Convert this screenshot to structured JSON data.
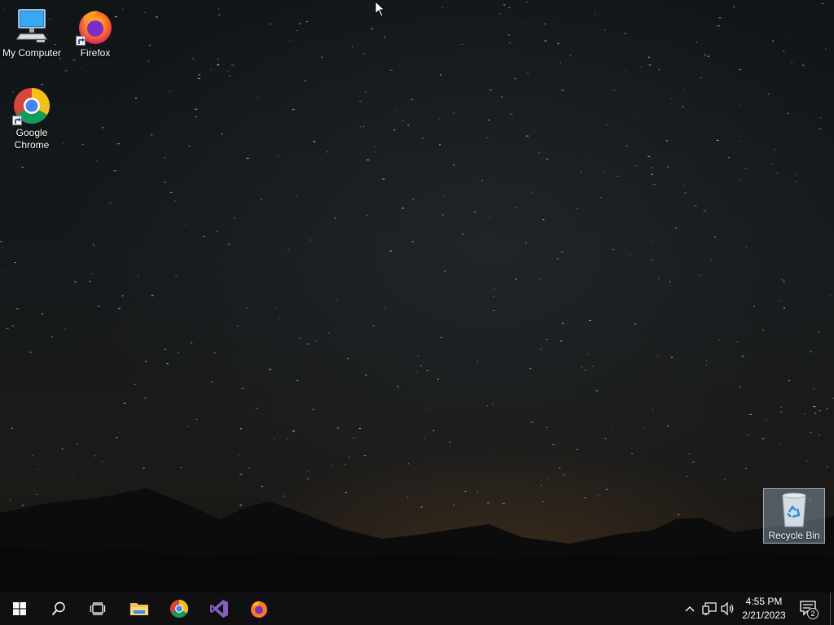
{
  "desktop": {
    "icons": [
      {
        "label": "My Computer",
        "icon": "computer-icon"
      },
      {
        "label": "Firefox",
        "icon": "firefox-icon"
      },
      {
        "label": "Google Chrome",
        "icon": "chrome-icon"
      },
      {
        "label": "Recycle Bin",
        "icon": "recycle-bin-icon"
      }
    ]
  },
  "taskbar": {
    "start": {
      "icon": "windows-logo-icon"
    },
    "search": {
      "icon": "search-icon"
    },
    "task_view": {
      "icon": "task-view-icon"
    },
    "pinned": [
      {
        "name": "File Explorer",
        "icon": "folder-icon"
      },
      {
        "name": "Google Chrome",
        "icon": "chrome-icon"
      },
      {
        "name": "Visual Studio",
        "icon": "visual-studio-icon"
      },
      {
        "name": "Firefox",
        "icon": "firefox-icon"
      }
    ],
    "tray": {
      "time": "4:55 PM",
      "date": "2/21/2023",
      "notification_count": "2"
    }
  },
  "colors": {
    "taskbar_bg": "#101010",
    "vs_purple": "#865fc5",
    "chrome_red": "#db4437",
    "chrome_yellow": "#f4c20d",
    "chrome_green": "#0f9d58",
    "chrome_blue": "#4285f4"
  }
}
